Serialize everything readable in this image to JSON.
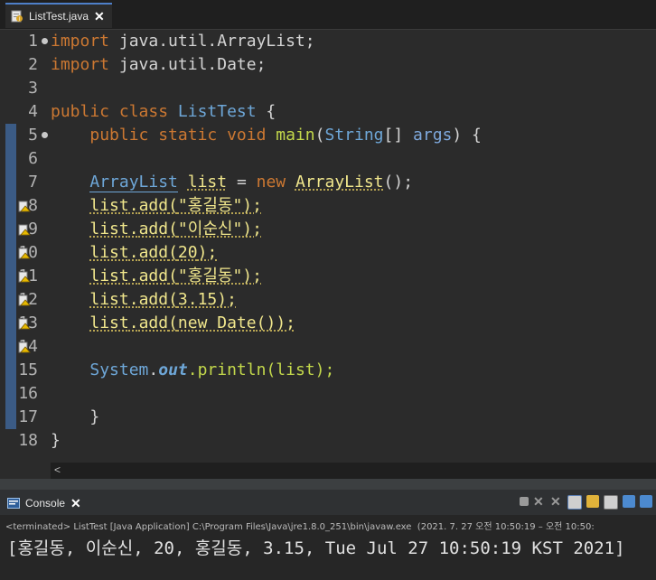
{
  "editor_tab": {
    "title": "ListTest.java"
  },
  "line_numbers": [
    "1",
    "2",
    "3",
    "4",
    "5",
    "6",
    "7",
    "8",
    "9",
    "10",
    "11",
    "12",
    "13",
    "14",
    "15",
    "16",
    "17",
    "18"
  ],
  "code": {
    "l1_kw": "import",
    "l1_rest": " java.util.ArrayList;",
    "l2_kw": "import",
    "l2_rest": " java.util.Date;",
    "l4_kw": "public class ",
    "l4_cls": "ListTest",
    "l4_rest": " {",
    "l5_indent": "    ",
    "l5_kw": "public static void ",
    "l5_method": "main",
    "l5_p1": "(",
    "l5_type": "String",
    "l5_p2": "[] ",
    "l5_param": "args",
    "l5_p3": ") {",
    "l7_indent": "    ",
    "l7_type": "ArrayList",
    "l7_sp": " ",
    "l7_var": "list",
    "l7_eq": " = ",
    "l7_new": "new ",
    "l7_type2": "ArrayList",
    "l7_end": "();",
    "l8_indent": "    ",
    "l8_obj": "list",
    "l8_dot": ".",
    "l8_m": "add",
    "l8_o": "(",
    "l8_arg": "\"홍길동\"",
    "l8_c": ");",
    "l9_indent": "    ",
    "l9_obj": "list",
    "l9_dot": ".",
    "l9_m": "add",
    "l9_o": "(",
    "l9_arg": "\"이순신\"",
    "l9_c": ");",
    "l10_indent": "    ",
    "l10_obj": "list",
    "l10_dot": ".",
    "l10_m": "add",
    "l10_o": "(",
    "l10_arg": "20",
    "l10_c": ");",
    "l11_indent": "    ",
    "l11_obj": "list",
    "l11_dot": ".",
    "l11_m": "add",
    "l11_o": "(",
    "l11_arg": "\"홍길동\"",
    "l11_c": ");",
    "l12_indent": "    ",
    "l12_obj": "list",
    "l12_dot": ".",
    "l12_m": "add",
    "l12_o": "(",
    "l12_arg": "3.15",
    "l12_c": ");",
    "l13_indent": "    ",
    "l13_obj": "list",
    "l13_dot": ".",
    "l13_m": "add",
    "l13_o": "(",
    "l13_new": "new ",
    "l13_cls": "Date",
    "l13_c": "());",
    "l15_indent": "    ",
    "l15_cls": "System",
    "l15_dot": ".",
    "l15_field": "out",
    "l15_m": ".println(",
    "l15_arg": "list",
    "l15_c": ");",
    "l17_indent": "    ",
    "l17_brace": "}",
    "l18_brace": "}"
  },
  "hscroll": {
    "left_arrow": "<"
  },
  "console": {
    "tab_title": "Console",
    "terminated": "<terminated> ListTest [Java Application] C:\\Program Files\\Java\\jre1.8.0_251\\bin\\javaw.exe  (2021. 7. 27 오전 10:50:19 – 오전 10:50:",
    "output": "[홍길동, 이순신, 20, 홍길동, 3.15, Tue Jul 27 10:50:19 KST 2021]"
  },
  "icons": {
    "java_file": "java-file-icon",
    "close": "close-icon",
    "warning": "warning-icon",
    "console": "console-icon",
    "tools": [
      "terminate-icon",
      "remove-launch-icon",
      "remove-all-icon",
      "scroll-lock-icon",
      "show-console-icon",
      "pin-icon",
      "display-selected-icon",
      "open-console-icon"
    ]
  },
  "colors": {
    "keyword": "#cc7832",
    "class": "#6ea7d8",
    "string": "#17c6a3",
    "number": "#6897bb",
    "method": "#c3d84b"
  }
}
